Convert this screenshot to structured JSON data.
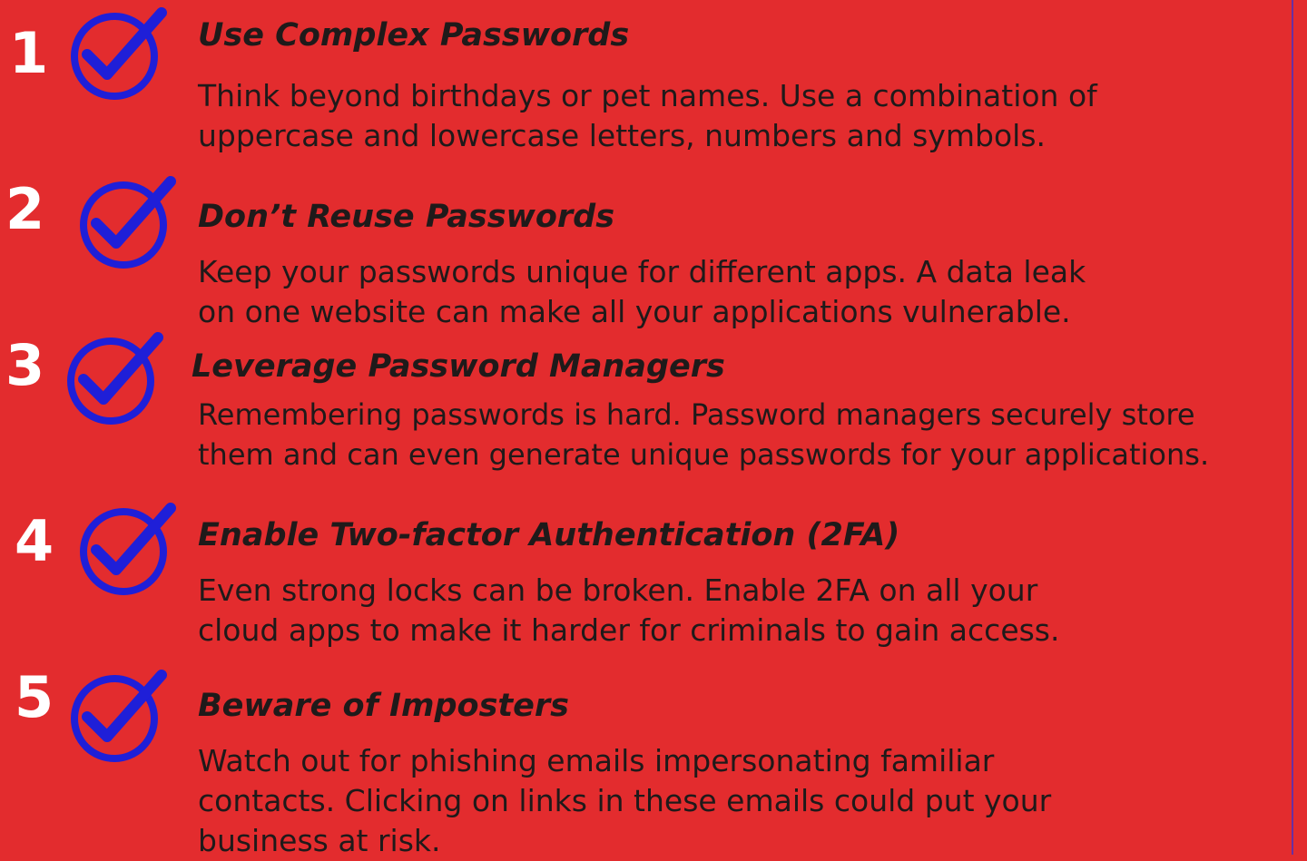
{
  "tips": [
    {
      "number": "1",
      "icon": "check-circle-icon",
      "title": "Use Complex Passwords",
      "lines": [
        "Think beyond birthdays or pet names. Use a combination of",
        "uppercase and lowercase letters, numbers and symbols."
      ]
    },
    {
      "number": "2",
      "icon": "check-circle-icon",
      "title": "Don’t Reuse Passwords",
      "lines": [
        "Keep your passwords unique for different apps. A data leak",
        "on one website can make all your applications vulnerable."
      ]
    },
    {
      "number": "3",
      "icon": "check-circle-icon",
      "title": "Leverage Password Managers",
      "lines": [
        "Remembering passwords is hard. Password managers securely store",
        "them and can even generate unique passwords for your applications."
      ]
    },
    {
      "number": "4",
      "icon": "check-circle-icon",
      "title": "Enable Two-factor Authentication (2FA)",
      "lines": [
        "Even strong locks can be broken. Enable 2FA on all your",
        "cloud apps to make it harder for criminals to gain access."
      ]
    },
    {
      "number": "5",
      "icon": "check-circle-icon",
      "title": "Beware of Imposters",
      "lines": [
        "Watch out for phishing emails impersonating familiar",
        "contacts. Clicking on links in these emails could put your",
        "business at risk."
      ]
    }
  ],
  "colors": {
    "background": "#e32c2e",
    "check": "#1f1fd8",
    "number": "#ffffff",
    "text": "#1f1a1a"
  }
}
